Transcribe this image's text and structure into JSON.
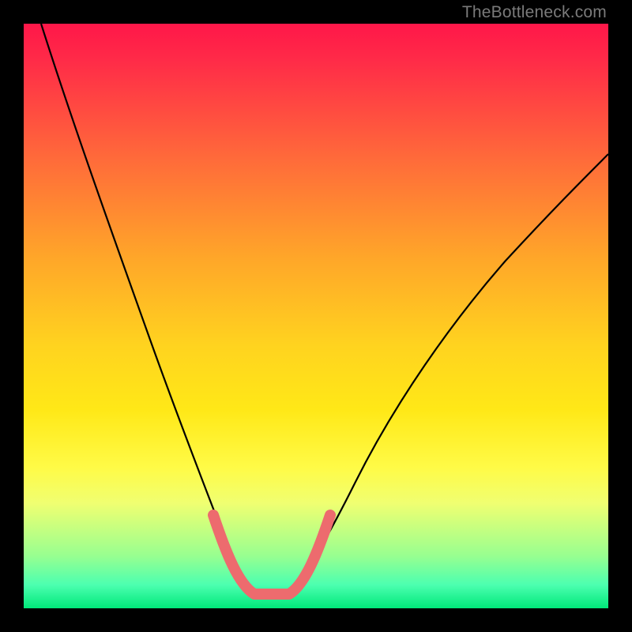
{
  "watermark": {
    "text": "TheBottleneck.com"
  },
  "chart_data": {
    "type": "line",
    "title": "",
    "xlabel": "",
    "ylabel": "",
    "xlim": [
      0,
      100
    ],
    "ylim": [
      0,
      100
    ],
    "grid": false,
    "series": [
      {
        "name": "bottleneck-curve",
        "color": "#000000",
        "x": [
          3,
          6,
          10,
          14,
          18,
          22,
          26,
          30,
          33,
          36,
          38,
          40,
          42,
          44,
          48,
          52,
          58,
          66,
          76,
          88,
          100
        ],
        "values": [
          100,
          91,
          80,
          69,
          58,
          48,
          38,
          28,
          20,
          13,
          8,
          4,
          2,
          4,
          8,
          15,
          24,
          35,
          46,
          56,
          65
        ]
      },
      {
        "name": "optimal-band",
        "color": "#ed6b6e",
        "x": [
          33,
          35,
          37,
          39,
          41,
          43,
          45,
          47,
          49,
          51
        ],
        "values": [
          16,
          11,
          6,
          3,
          2,
          2,
          3,
          6,
          11,
          16
        ]
      }
    ],
    "background_gradient": {
      "direction": "vertical",
      "stops": [
        {
          "pos": 0.0,
          "color": "#ff1749"
        },
        {
          "pos": 0.4,
          "color": "#ffa629"
        },
        {
          "pos": 0.66,
          "color": "#ffe817"
        },
        {
          "pos": 0.91,
          "color": "#98ff90"
        },
        {
          "pos": 1.0,
          "color": "#00e87a"
        }
      ],
      "meaning": "red high → green low (bottleneck percentage)"
    }
  }
}
